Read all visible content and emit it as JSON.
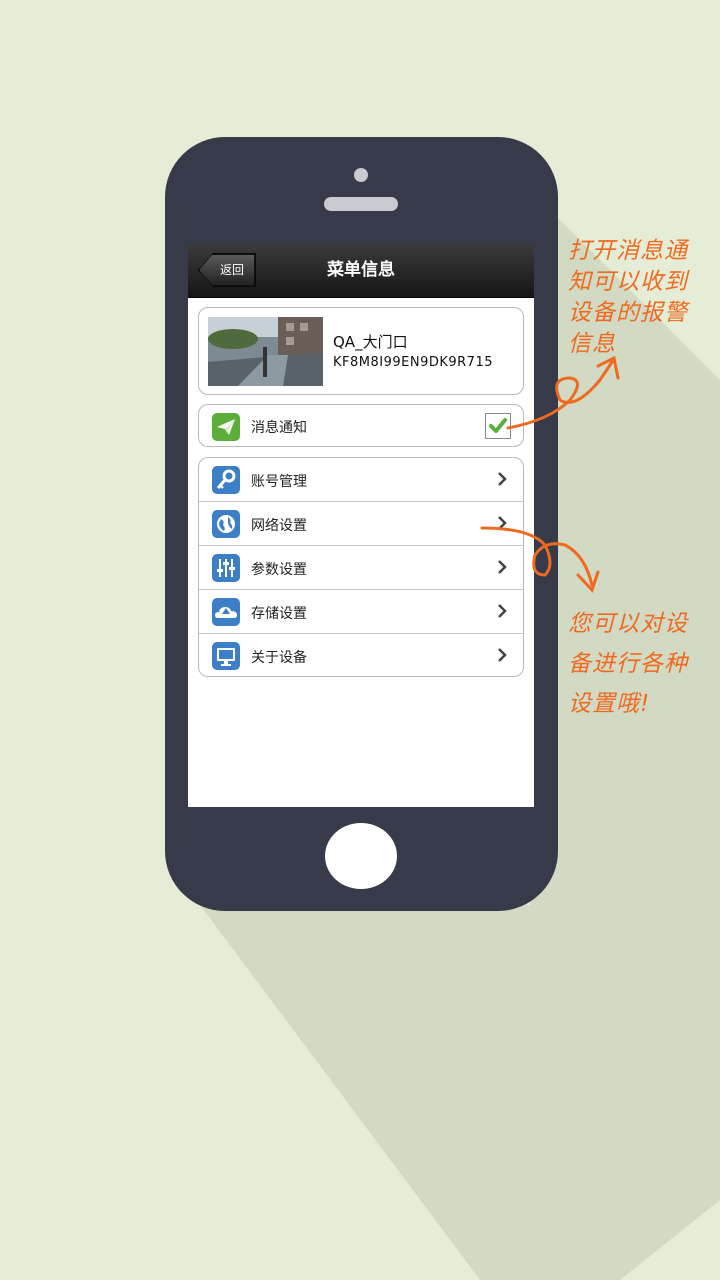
{
  "header": {
    "back_label": "返回",
    "title": "菜单信息"
  },
  "device": {
    "name": "QA_大门口",
    "id": "KF8M8I99EN9DK9R715"
  },
  "notification": {
    "label": "消息通知",
    "checked": true
  },
  "settings": [
    {
      "label": "账号管理",
      "icon": "key-icon"
    },
    {
      "label": "网络设置",
      "icon": "globe-icon"
    },
    {
      "label": "参数设置",
      "icon": "sliders-icon"
    },
    {
      "label": "存储设置",
      "icon": "cloud-icon"
    },
    {
      "label": "关于设备",
      "icon": "monitor-icon"
    }
  ],
  "annotations": {
    "top": [
      "打开消息通",
      "知可以收到",
      "设备的报警",
      "信息"
    ],
    "bottom": [
      "您可以对设",
      "备进行各种",
      "设置哦!"
    ]
  },
  "colors": {
    "background": "#e6edd6",
    "phone_body": "#363a49",
    "annotation": "#ee6a20",
    "icon_blue": "#3d7fc7",
    "icon_green": "#5cae3a"
  }
}
